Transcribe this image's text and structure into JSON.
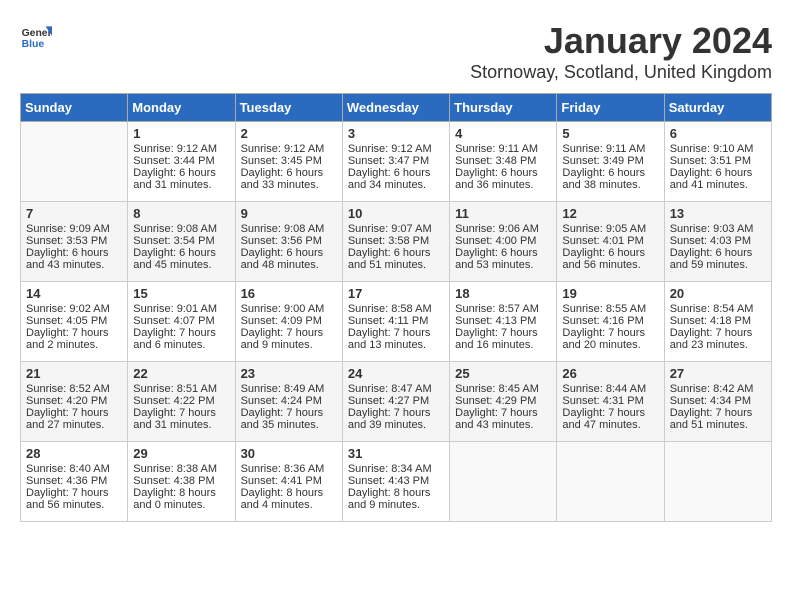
{
  "header": {
    "logo_general": "General",
    "logo_blue": "Blue",
    "month_title": "January 2024",
    "location": "Stornoway, Scotland, United Kingdom"
  },
  "weekdays": [
    "Sunday",
    "Monday",
    "Tuesday",
    "Wednesday",
    "Thursday",
    "Friday",
    "Saturday"
  ],
  "weeks": [
    [
      {
        "day": "",
        "sunrise": "",
        "sunset": "",
        "daylight": ""
      },
      {
        "day": "1",
        "sunrise": "Sunrise: 9:12 AM",
        "sunset": "Sunset: 3:44 PM",
        "daylight": "Daylight: 6 hours and 31 minutes."
      },
      {
        "day": "2",
        "sunrise": "Sunrise: 9:12 AM",
        "sunset": "Sunset: 3:45 PM",
        "daylight": "Daylight: 6 hours and 33 minutes."
      },
      {
        "day": "3",
        "sunrise": "Sunrise: 9:12 AM",
        "sunset": "Sunset: 3:47 PM",
        "daylight": "Daylight: 6 hours and 34 minutes."
      },
      {
        "day": "4",
        "sunrise": "Sunrise: 9:11 AM",
        "sunset": "Sunset: 3:48 PM",
        "daylight": "Daylight: 6 hours and 36 minutes."
      },
      {
        "day": "5",
        "sunrise": "Sunrise: 9:11 AM",
        "sunset": "Sunset: 3:49 PM",
        "daylight": "Daylight: 6 hours and 38 minutes."
      },
      {
        "day": "6",
        "sunrise": "Sunrise: 9:10 AM",
        "sunset": "Sunset: 3:51 PM",
        "daylight": "Daylight: 6 hours and 41 minutes."
      }
    ],
    [
      {
        "day": "7",
        "sunrise": "Sunrise: 9:09 AM",
        "sunset": "Sunset: 3:53 PM",
        "daylight": "Daylight: 6 hours and 43 minutes."
      },
      {
        "day": "8",
        "sunrise": "Sunrise: 9:08 AM",
        "sunset": "Sunset: 3:54 PM",
        "daylight": "Daylight: 6 hours and 45 minutes."
      },
      {
        "day": "9",
        "sunrise": "Sunrise: 9:08 AM",
        "sunset": "Sunset: 3:56 PM",
        "daylight": "Daylight: 6 hours and 48 minutes."
      },
      {
        "day": "10",
        "sunrise": "Sunrise: 9:07 AM",
        "sunset": "Sunset: 3:58 PM",
        "daylight": "Daylight: 6 hours and 51 minutes."
      },
      {
        "day": "11",
        "sunrise": "Sunrise: 9:06 AM",
        "sunset": "Sunset: 4:00 PM",
        "daylight": "Daylight: 6 hours and 53 minutes."
      },
      {
        "day": "12",
        "sunrise": "Sunrise: 9:05 AM",
        "sunset": "Sunset: 4:01 PM",
        "daylight": "Daylight: 6 hours and 56 minutes."
      },
      {
        "day": "13",
        "sunrise": "Sunrise: 9:03 AM",
        "sunset": "Sunset: 4:03 PM",
        "daylight": "Daylight: 6 hours and 59 minutes."
      }
    ],
    [
      {
        "day": "14",
        "sunrise": "Sunrise: 9:02 AM",
        "sunset": "Sunset: 4:05 PM",
        "daylight": "Daylight: 7 hours and 2 minutes."
      },
      {
        "day": "15",
        "sunrise": "Sunrise: 9:01 AM",
        "sunset": "Sunset: 4:07 PM",
        "daylight": "Daylight: 7 hours and 6 minutes."
      },
      {
        "day": "16",
        "sunrise": "Sunrise: 9:00 AM",
        "sunset": "Sunset: 4:09 PM",
        "daylight": "Daylight: 7 hours and 9 minutes."
      },
      {
        "day": "17",
        "sunrise": "Sunrise: 8:58 AM",
        "sunset": "Sunset: 4:11 PM",
        "daylight": "Daylight: 7 hours and 13 minutes."
      },
      {
        "day": "18",
        "sunrise": "Sunrise: 8:57 AM",
        "sunset": "Sunset: 4:13 PM",
        "daylight": "Daylight: 7 hours and 16 minutes."
      },
      {
        "day": "19",
        "sunrise": "Sunrise: 8:55 AM",
        "sunset": "Sunset: 4:16 PM",
        "daylight": "Daylight: 7 hours and 20 minutes."
      },
      {
        "day": "20",
        "sunrise": "Sunrise: 8:54 AM",
        "sunset": "Sunset: 4:18 PM",
        "daylight": "Daylight: 7 hours and 23 minutes."
      }
    ],
    [
      {
        "day": "21",
        "sunrise": "Sunrise: 8:52 AM",
        "sunset": "Sunset: 4:20 PM",
        "daylight": "Daylight: 7 hours and 27 minutes."
      },
      {
        "day": "22",
        "sunrise": "Sunrise: 8:51 AM",
        "sunset": "Sunset: 4:22 PM",
        "daylight": "Daylight: 7 hours and 31 minutes."
      },
      {
        "day": "23",
        "sunrise": "Sunrise: 8:49 AM",
        "sunset": "Sunset: 4:24 PM",
        "daylight": "Daylight: 7 hours and 35 minutes."
      },
      {
        "day": "24",
        "sunrise": "Sunrise: 8:47 AM",
        "sunset": "Sunset: 4:27 PM",
        "daylight": "Daylight: 7 hours and 39 minutes."
      },
      {
        "day": "25",
        "sunrise": "Sunrise: 8:45 AM",
        "sunset": "Sunset: 4:29 PM",
        "daylight": "Daylight: 7 hours and 43 minutes."
      },
      {
        "day": "26",
        "sunrise": "Sunrise: 8:44 AM",
        "sunset": "Sunset: 4:31 PM",
        "daylight": "Daylight: 7 hours and 47 minutes."
      },
      {
        "day": "27",
        "sunrise": "Sunrise: 8:42 AM",
        "sunset": "Sunset: 4:34 PM",
        "daylight": "Daylight: 7 hours and 51 minutes."
      }
    ],
    [
      {
        "day": "28",
        "sunrise": "Sunrise: 8:40 AM",
        "sunset": "Sunset: 4:36 PM",
        "daylight": "Daylight: 7 hours and 56 minutes."
      },
      {
        "day": "29",
        "sunrise": "Sunrise: 8:38 AM",
        "sunset": "Sunset: 4:38 PM",
        "daylight": "Daylight: 8 hours and 0 minutes."
      },
      {
        "day": "30",
        "sunrise": "Sunrise: 8:36 AM",
        "sunset": "Sunset: 4:41 PM",
        "daylight": "Daylight: 8 hours and 4 minutes."
      },
      {
        "day": "31",
        "sunrise": "Sunrise: 8:34 AM",
        "sunset": "Sunset: 4:43 PM",
        "daylight": "Daylight: 8 hours and 9 minutes."
      },
      {
        "day": "",
        "sunrise": "",
        "sunset": "",
        "daylight": ""
      },
      {
        "day": "",
        "sunrise": "",
        "sunset": "",
        "daylight": ""
      },
      {
        "day": "",
        "sunrise": "",
        "sunset": "",
        "daylight": ""
      }
    ]
  ]
}
